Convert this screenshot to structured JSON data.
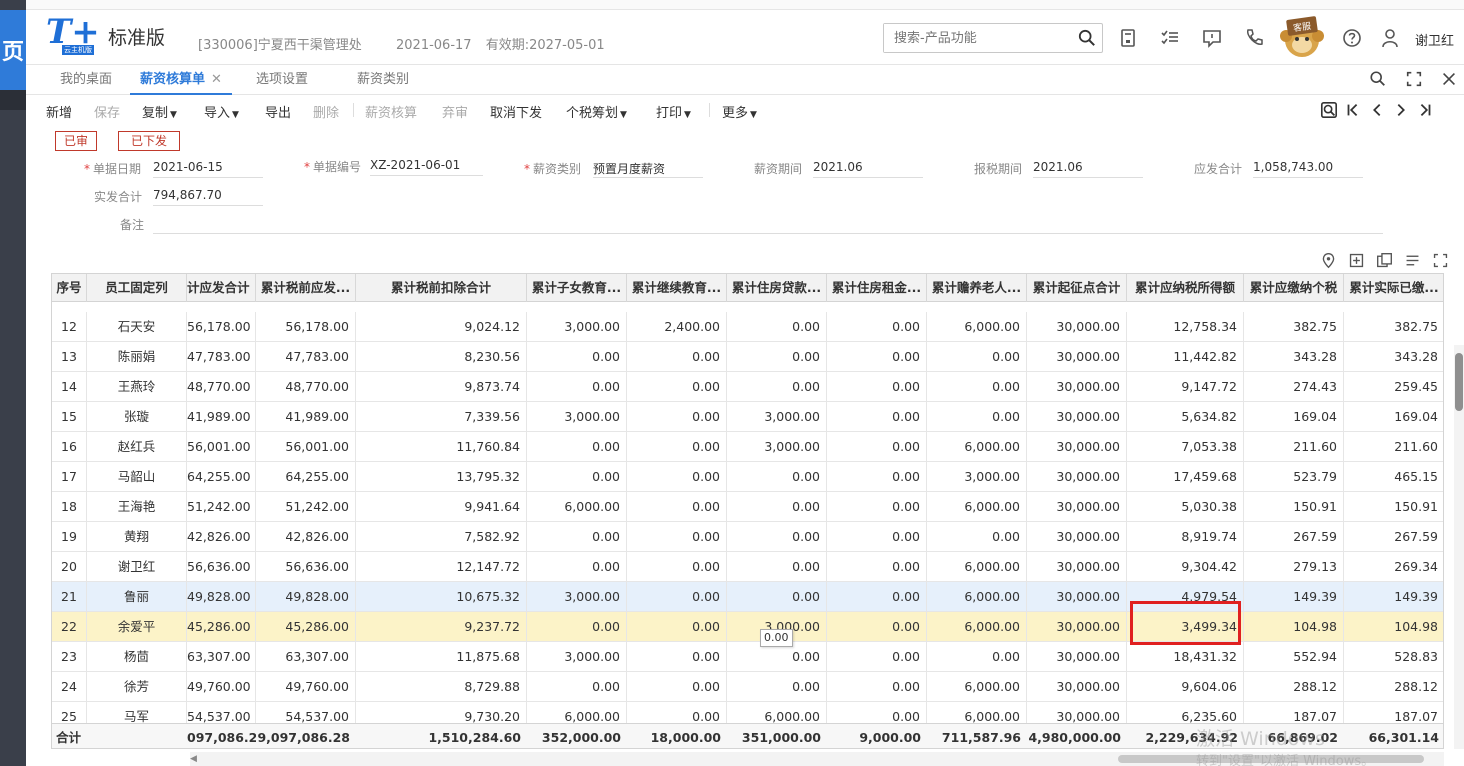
{
  "left_panel": {
    "glyph": "页"
  },
  "header": {
    "logo_mark": "T+",
    "logo_sub": "云主机版",
    "edition": "标准版",
    "company": "[330006]宁夏西干渠管理处",
    "login_date": "2021-06-17",
    "valid_until": "有效期:2027-05-01",
    "search_placeholder": "搜索-产品功能",
    "kefu_label": "客服",
    "user_name": "谢卫红"
  },
  "tabs": [
    {
      "label": "我的桌面"
    },
    {
      "label": "薪资核算单"
    },
    {
      "label": "选项设置"
    },
    {
      "label": "薪资类别"
    }
  ],
  "toolbar": {
    "new": "新增",
    "save": "保存",
    "copy": "复制",
    "import": "导入",
    "export": "导出",
    "delete": "删除",
    "calculate": "薪资核算",
    "abandon": "弃审",
    "cancel_issue": "取消下发",
    "tax_plan": "个税筹划",
    "print": "打印",
    "more": "更多"
  },
  "status": {
    "approved": "已审",
    "issued": "已下发"
  },
  "form": {
    "doc_date_label": "单据日期",
    "doc_date": "2021-06-15",
    "doc_no_label": "单据编号",
    "doc_no": "XZ-2021-06-01",
    "salary_type_label": "薪资类别",
    "salary_type": "预置月度薪资",
    "salary_period_label": "薪资期间",
    "salary_period": "2021.06",
    "tax_period_label": "报税期间",
    "tax_period": "2021.06",
    "gross_total_label": "应发合计",
    "gross_total": "1,058,743.00",
    "net_total_label": "实发合计",
    "net_total": "794,867.70",
    "remark_label": "备注",
    "remark": ""
  },
  "grid": {
    "headers": [
      "序号",
      "员工固定列",
      "计应发合计",
      "累计税前应发...",
      "累计税前扣除合计",
      "累计子女教育...",
      "累计继续教育...",
      "累计住房贷款...",
      "累计住房租金...",
      "累计赡养老人...",
      "累计起征点合计",
      "累计应纳税所得额",
      "累计应缴纳个税",
      "累计实际已缴..."
    ],
    "rows": [
      [
        "12",
        "石天安",
        "56,178.00",
        "56,178.00",
        "9,024.12",
        "3,000.00",
        "2,400.00",
        "0.00",
        "0.00",
        "6,000.00",
        "30,000.00",
        "12,758.34",
        "382.75",
        "382.75"
      ],
      [
        "13",
        "陈丽娟",
        "47,783.00",
        "47,783.00",
        "8,230.56",
        "0.00",
        "0.00",
        "0.00",
        "0.00",
        "0.00",
        "30,000.00",
        "11,442.82",
        "343.28",
        "343.28"
      ],
      [
        "14",
        "王燕玲",
        "48,770.00",
        "48,770.00",
        "9,873.74",
        "0.00",
        "0.00",
        "0.00",
        "0.00",
        "0.00",
        "30,000.00",
        "9,147.72",
        "274.43",
        "259.45"
      ],
      [
        "15",
        "张璇",
        "41,989.00",
        "41,989.00",
        "7,339.56",
        "3,000.00",
        "0.00",
        "3,000.00",
        "0.00",
        "0.00",
        "30,000.00",
        "5,634.82",
        "169.04",
        "169.04"
      ],
      [
        "16",
        "赵红兵",
        "56,001.00",
        "56,001.00",
        "11,760.84",
        "0.00",
        "0.00",
        "3,000.00",
        "0.00",
        "6,000.00",
        "30,000.00",
        "7,053.38",
        "211.60",
        "211.60"
      ],
      [
        "17",
        "马韶山",
        "64,255.00",
        "64,255.00",
        "13,795.32",
        "0.00",
        "0.00",
        "0.00",
        "0.00",
        "3,000.00",
        "30,000.00",
        "17,459.68",
        "523.79",
        "465.15"
      ],
      [
        "18",
        "王海艳",
        "51,242.00",
        "51,242.00",
        "9,941.64",
        "6,000.00",
        "0.00",
        "0.00",
        "0.00",
        "6,000.00",
        "30,000.00",
        "5,030.38",
        "150.91",
        "150.91"
      ],
      [
        "19",
        "黄翔",
        "42,826.00",
        "42,826.00",
        "7,582.92",
        "0.00",
        "0.00",
        "0.00",
        "0.00",
        "0.00",
        "30,000.00",
        "8,919.74",
        "267.59",
        "267.59"
      ],
      [
        "20",
        "谢卫红",
        "56,636.00",
        "56,636.00",
        "12,147.72",
        "0.00",
        "0.00",
        "0.00",
        "0.00",
        "6,000.00",
        "30,000.00",
        "9,304.42",
        "279.13",
        "269.34"
      ],
      [
        "21",
        "鲁丽",
        "49,828.00",
        "49,828.00",
        "10,675.32",
        "3,000.00",
        "0.00",
        "0.00",
        "0.00",
        "6,000.00",
        "30,000.00",
        "4,979.54",
        "149.39",
        "149.39"
      ],
      [
        "22",
        "余爱平",
        "45,286.00",
        "45,286.00",
        "9,237.72",
        "0.00",
        "0.00",
        "3,000.00",
        "0.00",
        "6,000.00",
        "30,000.00",
        "3,499.34",
        "104.98",
        "104.98"
      ],
      [
        "23",
        "杨茴",
        "63,307.00",
        "63,307.00",
        "11,875.68",
        "3,000.00",
        "0.00",
        "0.00",
        "0.00",
        "0.00",
        "30,000.00",
        "18,431.32",
        "552.94",
        "528.83"
      ],
      [
        "24",
        "徐芳",
        "49,760.00",
        "49,760.00",
        "8,729.88",
        "0.00",
        "0.00",
        "0.00",
        "0.00",
        "6,000.00",
        "30,000.00",
        "9,604.06",
        "288.12",
        "288.12"
      ],
      [
        "25",
        "马军",
        "54,537.00",
        "54,537.00",
        "9,730.20",
        "6,000.00",
        "0.00",
        "6,000.00",
        "0.00",
        "6,000.00",
        "30,000.00",
        "6,235.60",
        "187.07",
        "187.07"
      ]
    ],
    "selected_row_index": 9,
    "current_row_index": 10,
    "footer": [
      "合计",
      "",
      "097,086.28",
      "9,097,086.28",
      "1,510,284.60",
      "352,000.00",
      "18,000.00",
      "351,000.00",
      "9,000.00",
      "711,587.96",
      "4,980,000.00",
      "2,229,634.92",
      "66,869.02",
      "66,301.14"
    ]
  },
  "tooltip": {
    "text": "0.00"
  },
  "watermark": {
    "line1": "激活 Windows",
    "line2": "转到\"设置\"以激活 Windows。"
  },
  "colors": {
    "accent": "#2f7bd9",
    "stamp_red": "#c0392b",
    "highlight_box": "#e02020",
    "selected_row": "#e6f0fb",
    "current_row": "#fcf3c8"
  }
}
